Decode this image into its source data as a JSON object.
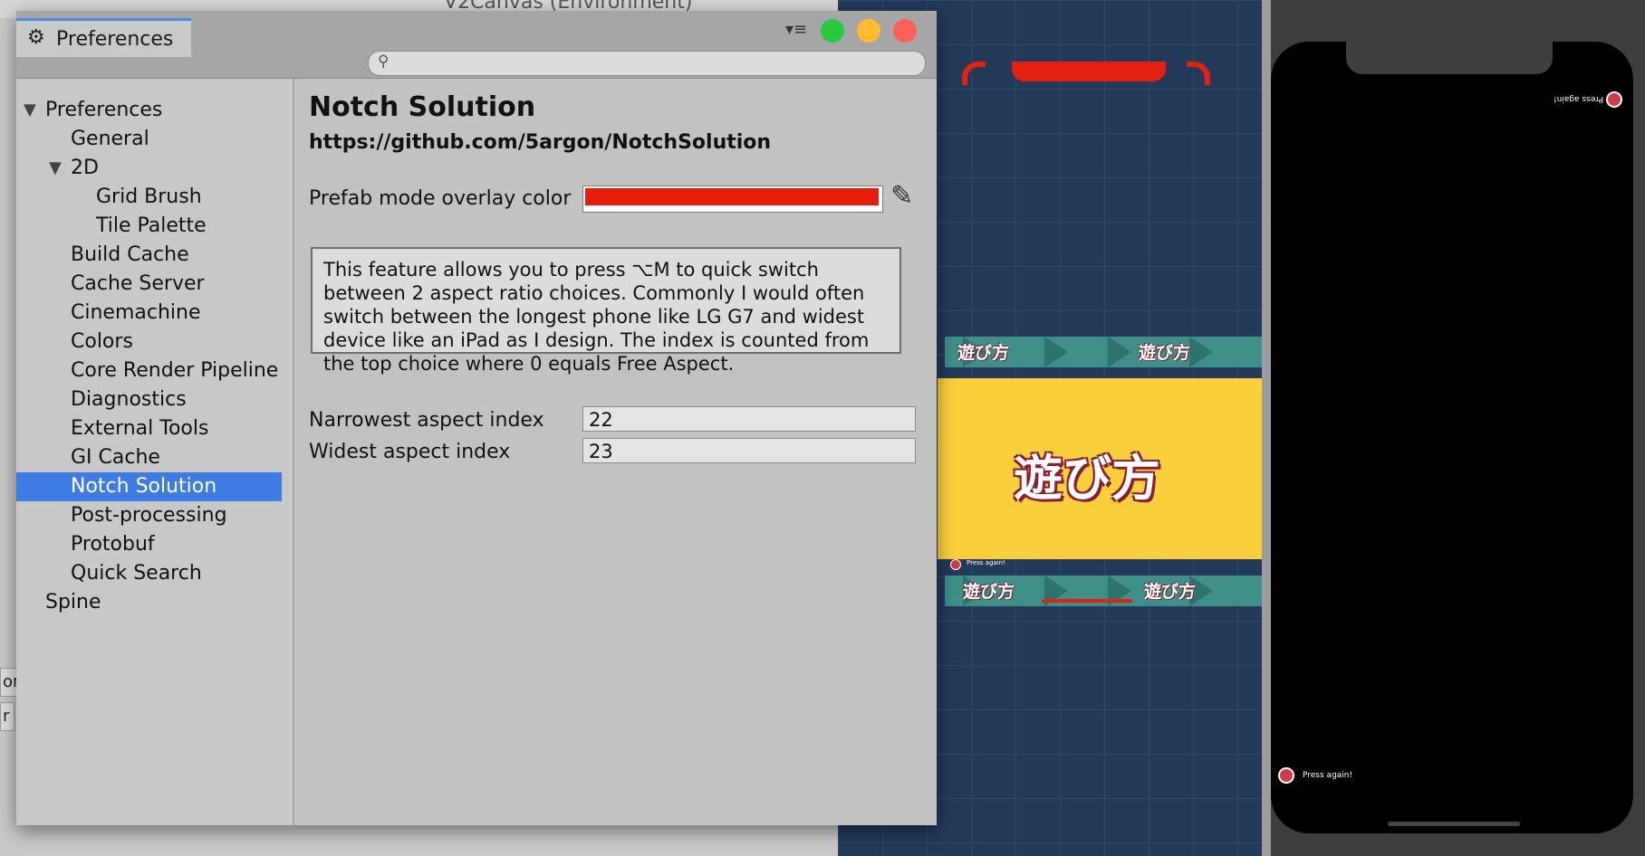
{
  "background": {
    "hierarchy_item": "V2Canvas (Environment)",
    "left_fields": [
      "or",
      "r"
    ]
  },
  "window": {
    "tab_title": "Preferences",
    "search_placeholder": "",
    "traffic_lights": {
      "green": "#27c93f",
      "yellow": "#ffbd2e",
      "red": "#ff5f57"
    }
  },
  "sidebar": {
    "items": [
      {
        "label": "Preferences",
        "level": 0,
        "expanded": true
      },
      {
        "label": "General",
        "level": 1
      },
      {
        "label": "2D",
        "level": 1,
        "expanded": true
      },
      {
        "label": "Grid Brush",
        "level": 2
      },
      {
        "label": "Tile Palette",
        "level": 2
      },
      {
        "label": "Build Cache",
        "level": 1
      },
      {
        "label": "Cache Server",
        "level": 1
      },
      {
        "label": "Cinemachine",
        "level": 1
      },
      {
        "label": "Colors",
        "level": 1
      },
      {
        "label": "Core Render Pipeline",
        "level": 1
      },
      {
        "label": "Diagnostics",
        "level": 1
      },
      {
        "label": "External Tools",
        "level": 1
      },
      {
        "label": "GI Cache",
        "level": 1
      },
      {
        "label": "Notch Solution",
        "level": 1,
        "selected": true
      },
      {
        "label": "Post-processing",
        "level": 1
      },
      {
        "label": "Protobuf",
        "level": 1
      },
      {
        "label": "Quick Search",
        "level": 1
      },
      {
        "label": "Spine",
        "level": 0
      }
    ]
  },
  "content": {
    "title": "Notch Solution",
    "url": "https://github.com/5argon/NotchSolution",
    "overlay_label": "Prefab mode overlay color",
    "overlay_color": "#e81e0b",
    "description": "This feature allows you to press ⌥M to quick switch between 2 aspect ratio choices. Commonly I would often switch between the longest phone like LG G7 and widest device like an iPad as I design. The index is counted from the top choice where 0 equals Free Aspect.",
    "narrowest_label": "Narrowest aspect index",
    "narrowest_value": "22",
    "widest_label": "Widest aspect index",
    "widest_value": "23"
  },
  "scene": {
    "band_text": "遊び方",
    "panel_title": "遊び方",
    "press_again": "Press again!"
  },
  "device": {
    "press_again_top": "Press again!",
    "press_again_bottom": "Press again!"
  }
}
